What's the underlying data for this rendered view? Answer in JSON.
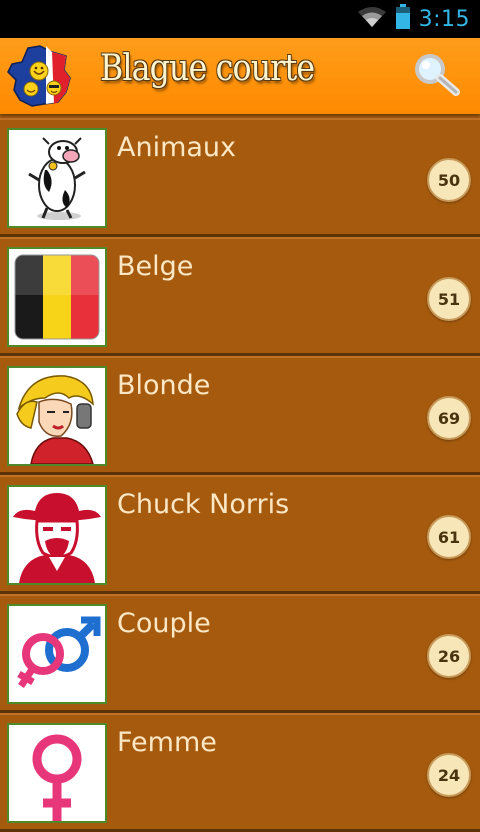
{
  "status_bar": {
    "time": "3:15",
    "icons": [
      "wifi-icon",
      "battery-icon"
    ]
  },
  "header": {
    "title": "Blague courte",
    "logo_icon": "france-map-smiley-icon",
    "search_icon": "magnifier-icon"
  },
  "colors": {
    "header_bg": "#ff9200",
    "list_bg": "#a55a0e",
    "divider": "#5c3208",
    "label_text": "#fbe7c4",
    "badge_bg": "#f6e6b8",
    "clock": "#33b5e5"
  },
  "categories": [
    {
      "label": "Animaux",
      "count": "50",
      "icon": "cow-icon"
    },
    {
      "label": "Belge",
      "count": "51",
      "icon": "belgian-flag-icon"
    },
    {
      "label": "Blonde",
      "count": "69",
      "icon": "blonde-woman-icon"
    },
    {
      "label": "Chuck Norris",
      "count": "61",
      "icon": "chuck-norris-icon"
    },
    {
      "label": "Couple",
      "count": "26",
      "icon": "couple-symbols-icon"
    },
    {
      "label": "Femme",
      "count": "24",
      "icon": "female-symbol-icon"
    }
  ]
}
